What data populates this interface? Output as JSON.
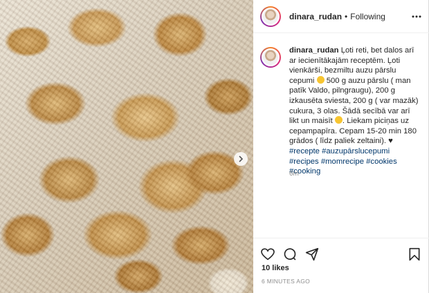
{
  "post": {
    "username": "dinara_rudan",
    "follow_separator": "•",
    "follow_status": "Following",
    "caption": {
      "username": "dinara_rudan",
      "text_1": "Ļoti reti, bet dalos arī ar iecienītākajām receptēm. Ļoti vienkārši, bezmiltu auzu pārslu cepumi ",
      "text_2": " 500 g auzu pārslu ( man patīk Valdo, pilngraugu), 200 g izkausēta sviesta, 200 g ( var mazāk) cukura, 3 olas. Šādā secībā var arī likt un maisīt ",
      "text_3": ". Liekam piciņas uz cepampapīra. Cepam 15-20 min 180 grādos ( līdz paliek zeltaini). ",
      "heart": "♥",
      "hashtags": [
        "#recepte",
        "#auzupārslucepumi",
        "#recipes",
        "#momrecipe",
        "#cookies",
        "#cooking"
      ]
    },
    "time_short": "6m",
    "likes": "10 likes",
    "time_ago": "6 MINUTES AGO"
  },
  "icons": {
    "more": "more-options-icon",
    "like": "heart-icon",
    "comment": "comment-icon",
    "share": "share-icon",
    "save": "bookmark-icon",
    "next": "chevron-right-icon"
  }
}
